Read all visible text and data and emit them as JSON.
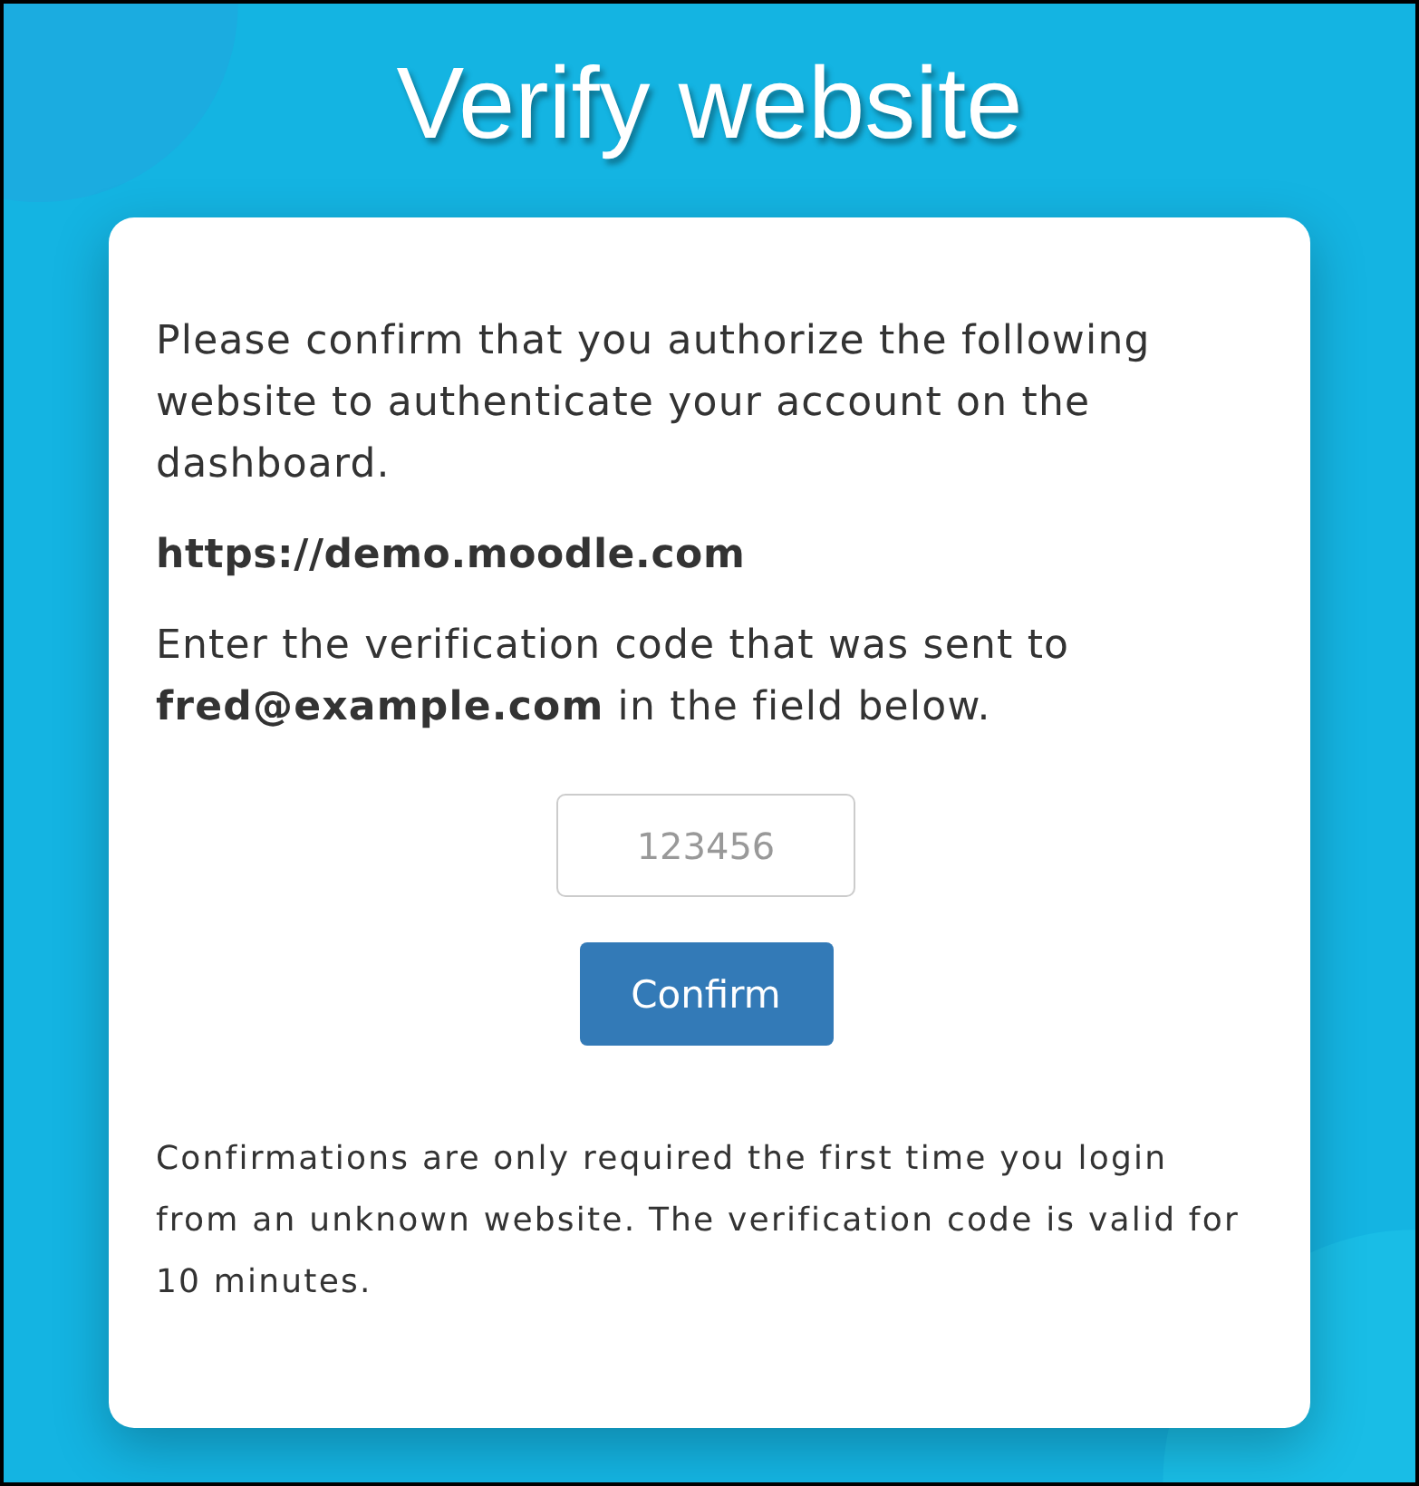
{
  "title": "Verify website",
  "card": {
    "intro": "Please confirm that you authorize the following website to authenticate your account on the dashboard.",
    "website": "https://demo.moodle.com",
    "instruction": "Enter the verification code that was sent to **fred@example.com** in the field below.",
    "code_field": {
      "placeholder": "123456"
    },
    "confirm_button": "Confirm",
    "note": "Confirmations are only required the first time you login from an unknown website. The verification code is valid for 10 minutes."
  }
}
